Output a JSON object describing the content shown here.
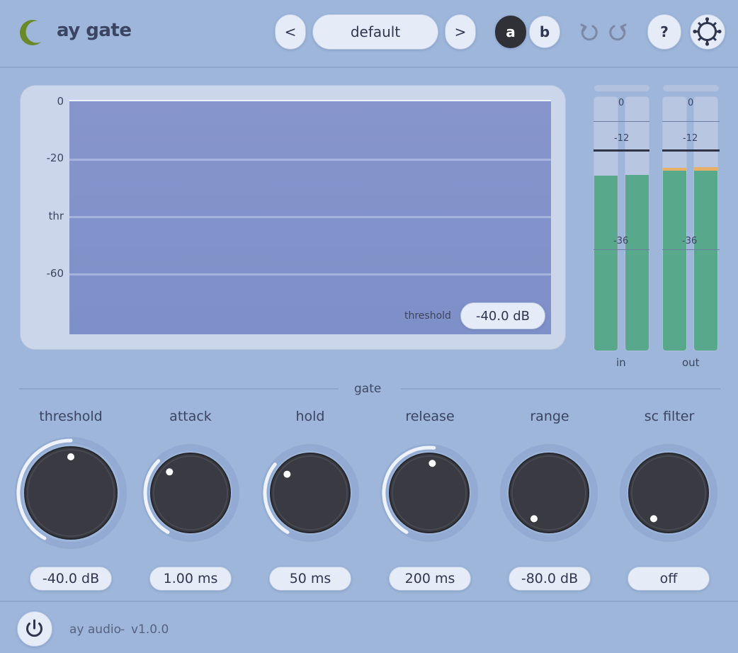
{
  "header": {
    "title": "ay gate",
    "prev_label": "<",
    "preset": "default",
    "next_label": ">",
    "ab_a": "a",
    "ab_b": "b",
    "help_label": "?",
    "logo_icon": "crescent-logo-icon",
    "undo_icon": "undo-icon",
    "redo_icon": "redo-icon",
    "settings_icon": "gear-icon"
  },
  "graph": {
    "y_labels": [
      "0",
      "-20",
      "thr",
      "-60"
    ],
    "threshold_label": "threshold",
    "threshold_value": "-40.0 dB"
  },
  "meters": {
    "in": {
      "label": "in",
      "tick_labels": [
        "0",
        "-12",
        "-36"
      ],
      "levels": [
        0.685,
        0.69
      ],
      "peaks": [
        0.0,
        0.0
      ]
    },
    "out": {
      "label": "out",
      "tick_labels": [
        "0",
        "-12",
        "-36"
      ],
      "levels": [
        0.705,
        0.705
      ],
      "peaks": [
        0.012,
        0.015
      ]
    }
  },
  "section": {
    "title": "gate"
  },
  "knobs": [
    {
      "label": "threshold",
      "value": "-40.0 dB",
      "fraction": 0.5
    },
    {
      "label": "attack",
      "value": "1.00 ms",
      "fraction": 0.35
    },
    {
      "label": "hold",
      "value": "50 ms",
      "fraction": 0.33
    },
    {
      "label": "release",
      "value": "200 ms",
      "fraction": 0.52
    },
    {
      "label": "range",
      "value": "-80.0 dB",
      "fraction": 0.0
    },
    {
      "label": "sc filter",
      "value": "off",
      "fraction": 0.0
    }
  ],
  "footer": {
    "brand": "ay audio",
    "separator": "-",
    "version": "v1.0.0",
    "power_icon": "power-icon"
  },
  "colors": {
    "background": "#9db6da",
    "meter_green": "#58a88c",
    "meter_peak": "#e6b068",
    "knob_body": "#3a3b42",
    "arc": "#eef2fa",
    "logo": "#6a8a2a"
  }
}
